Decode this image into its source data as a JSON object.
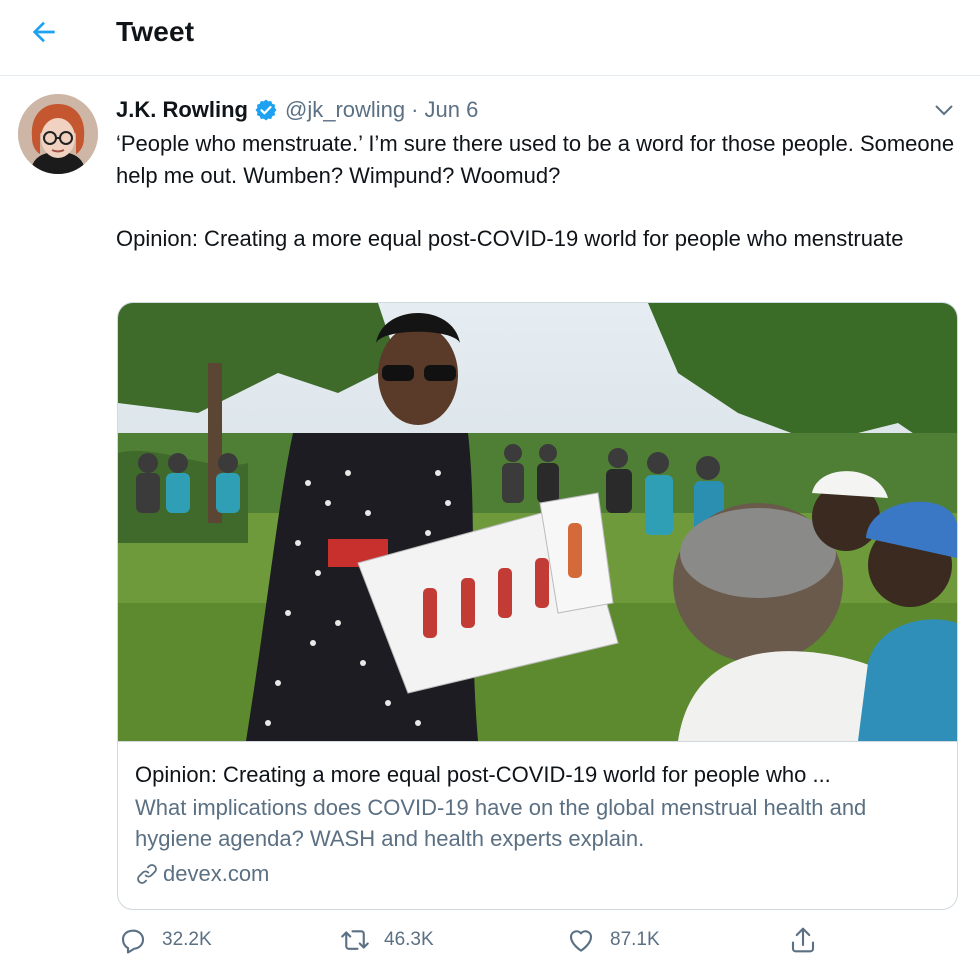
{
  "header": {
    "title": "Tweet",
    "back_icon": "arrow-left-icon"
  },
  "tweet": {
    "author_name": "J.K. Rowling",
    "handle": "@jk_rowling",
    "separator": "·",
    "date": "Jun 6",
    "verified_icon": "verified-badge-icon",
    "text_line1": "‘People who menstruate.’ I’m sure there used to be a word for those people. Someone help me out. Wumben? Wimpund? Woomud?",
    "text_line2": "Opinion: Creating a more equal post-COVID-19 world for people who menstruate"
  },
  "card": {
    "title": "Opinion: Creating a more equal post-COVID-19 world for people who ...",
    "description": "What implications does COVID-19 have on the global menstrual health and hygiene agenda? WASH and health experts explain.",
    "domain": "devex.com"
  },
  "actions": {
    "replies": "32.2K",
    "retweets": "46.3K",
    "likes": "87.1K"
  },
  "colors": {
    "accent": "#1da1f2",
    "muted": "#5b7083",
    "border": "#cfd9de"
  }
}
